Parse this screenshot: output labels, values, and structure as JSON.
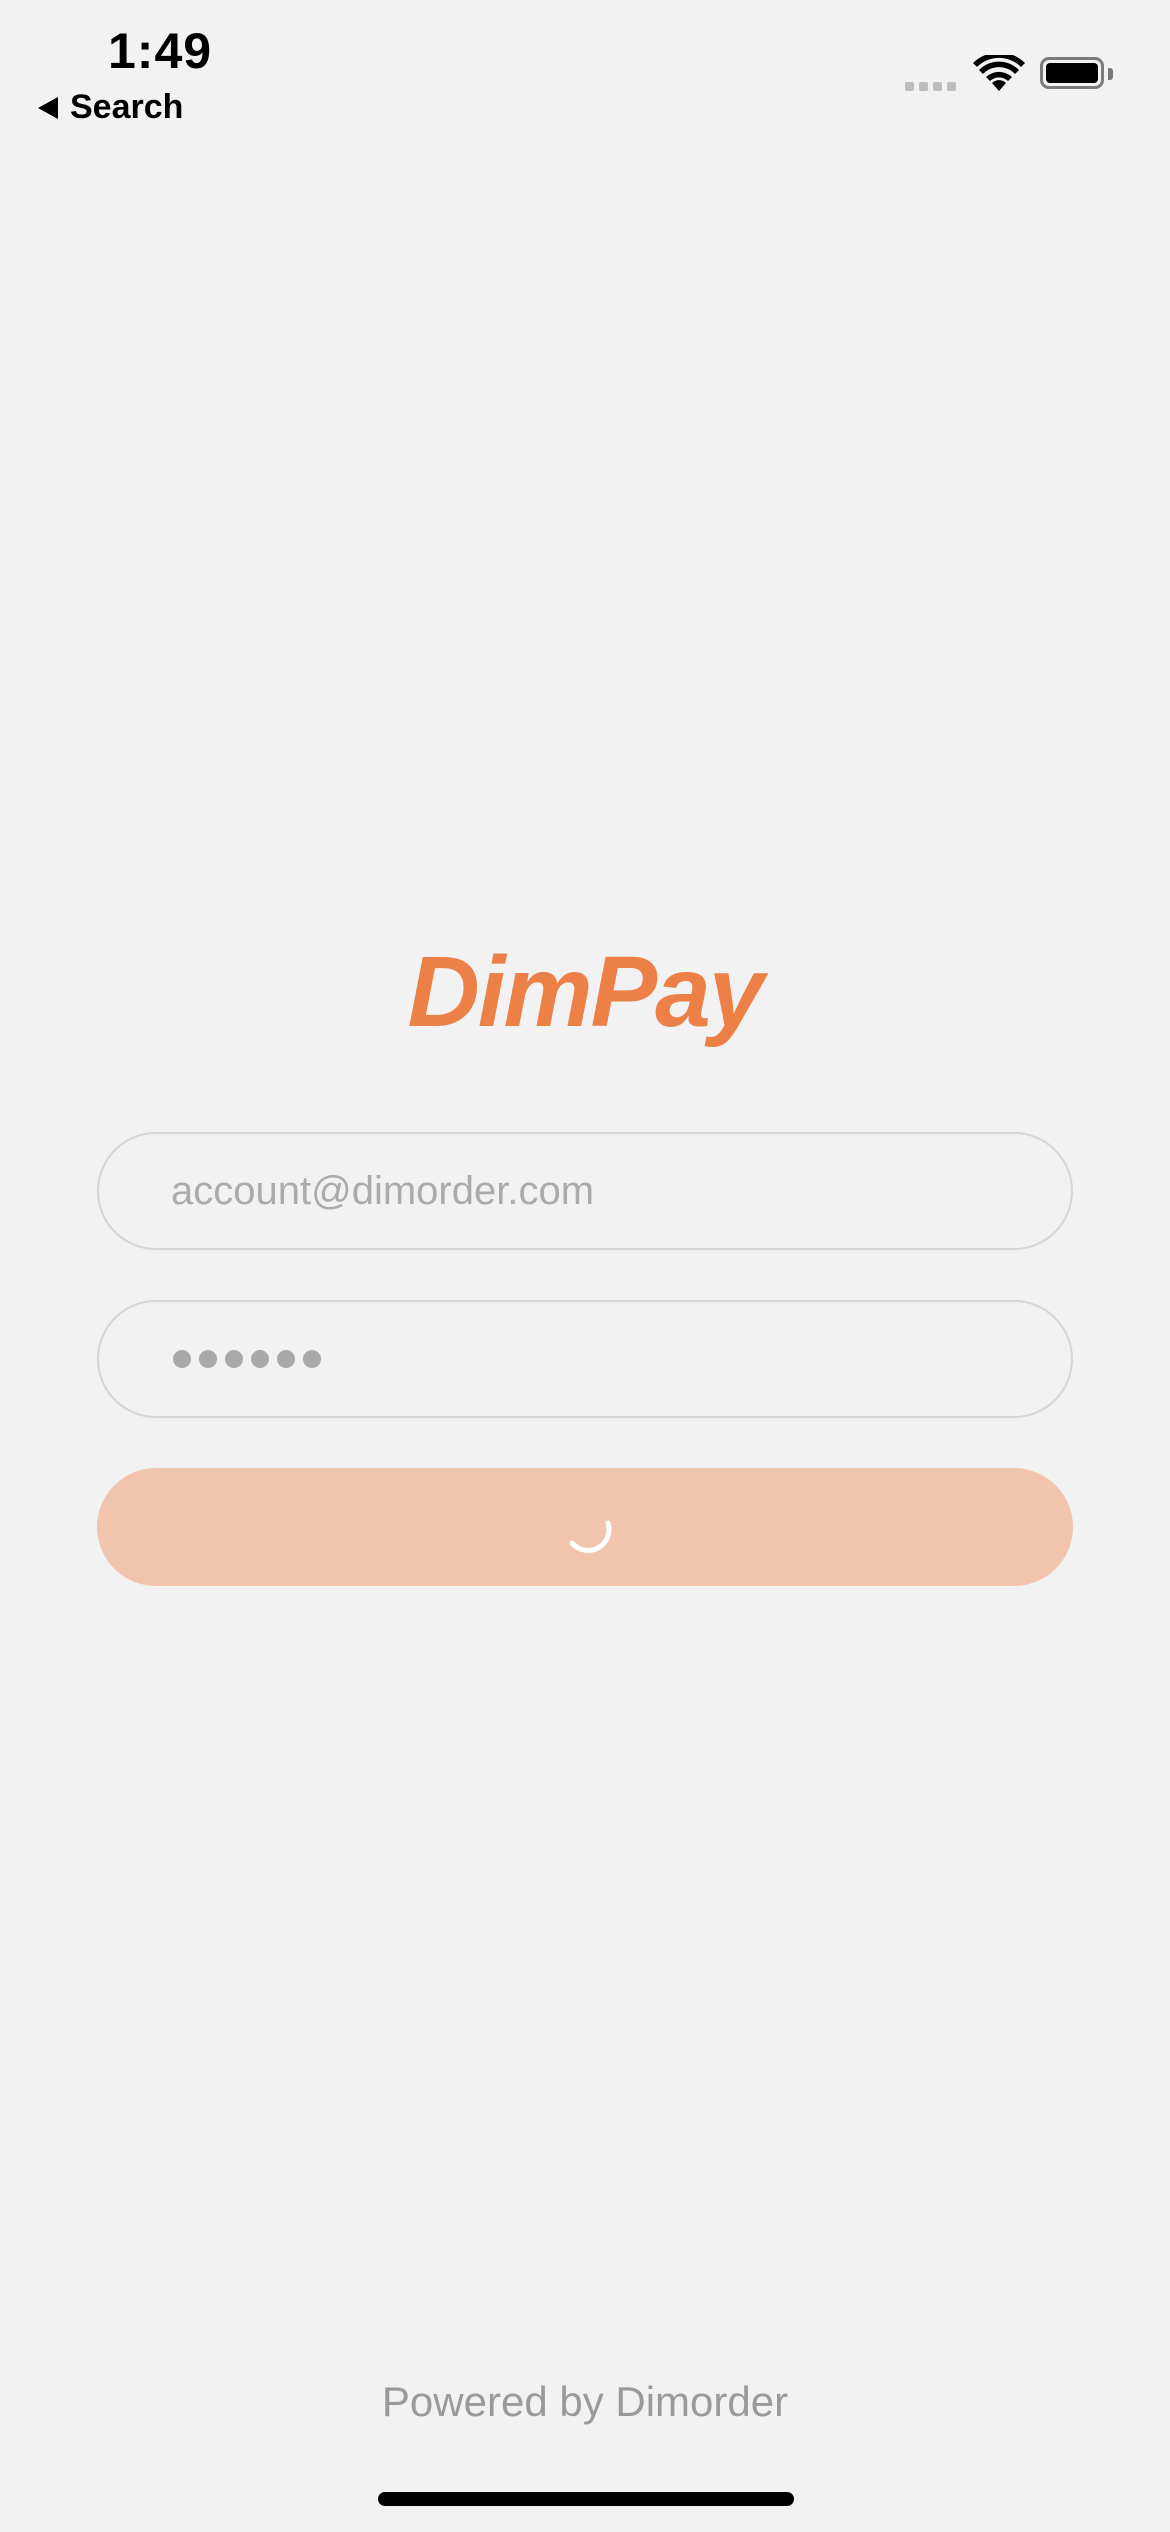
{
  "status_bar": {
    "time": "1:49",
    "back_label": "Search"
  },
  "app": {
    "logo_text": "DimPay",
    "brand_color": "#ec8047"
  },
  "login": {
    "email_placeholder": "account@dimorder.com",
    "password_masked_length": 6,
    "button_state": "loading",
    "button_color": "#f1c5ad"
  },
  "footer": {
    "powered_by": "Powered by Dimorder"
  },
  "icons": [
    "back-arrow-icon",
    "cellular-signal-icon",
    "wifi-icon",
    "battery-icon",
    "loading-spinner-icon"
  ]
}
